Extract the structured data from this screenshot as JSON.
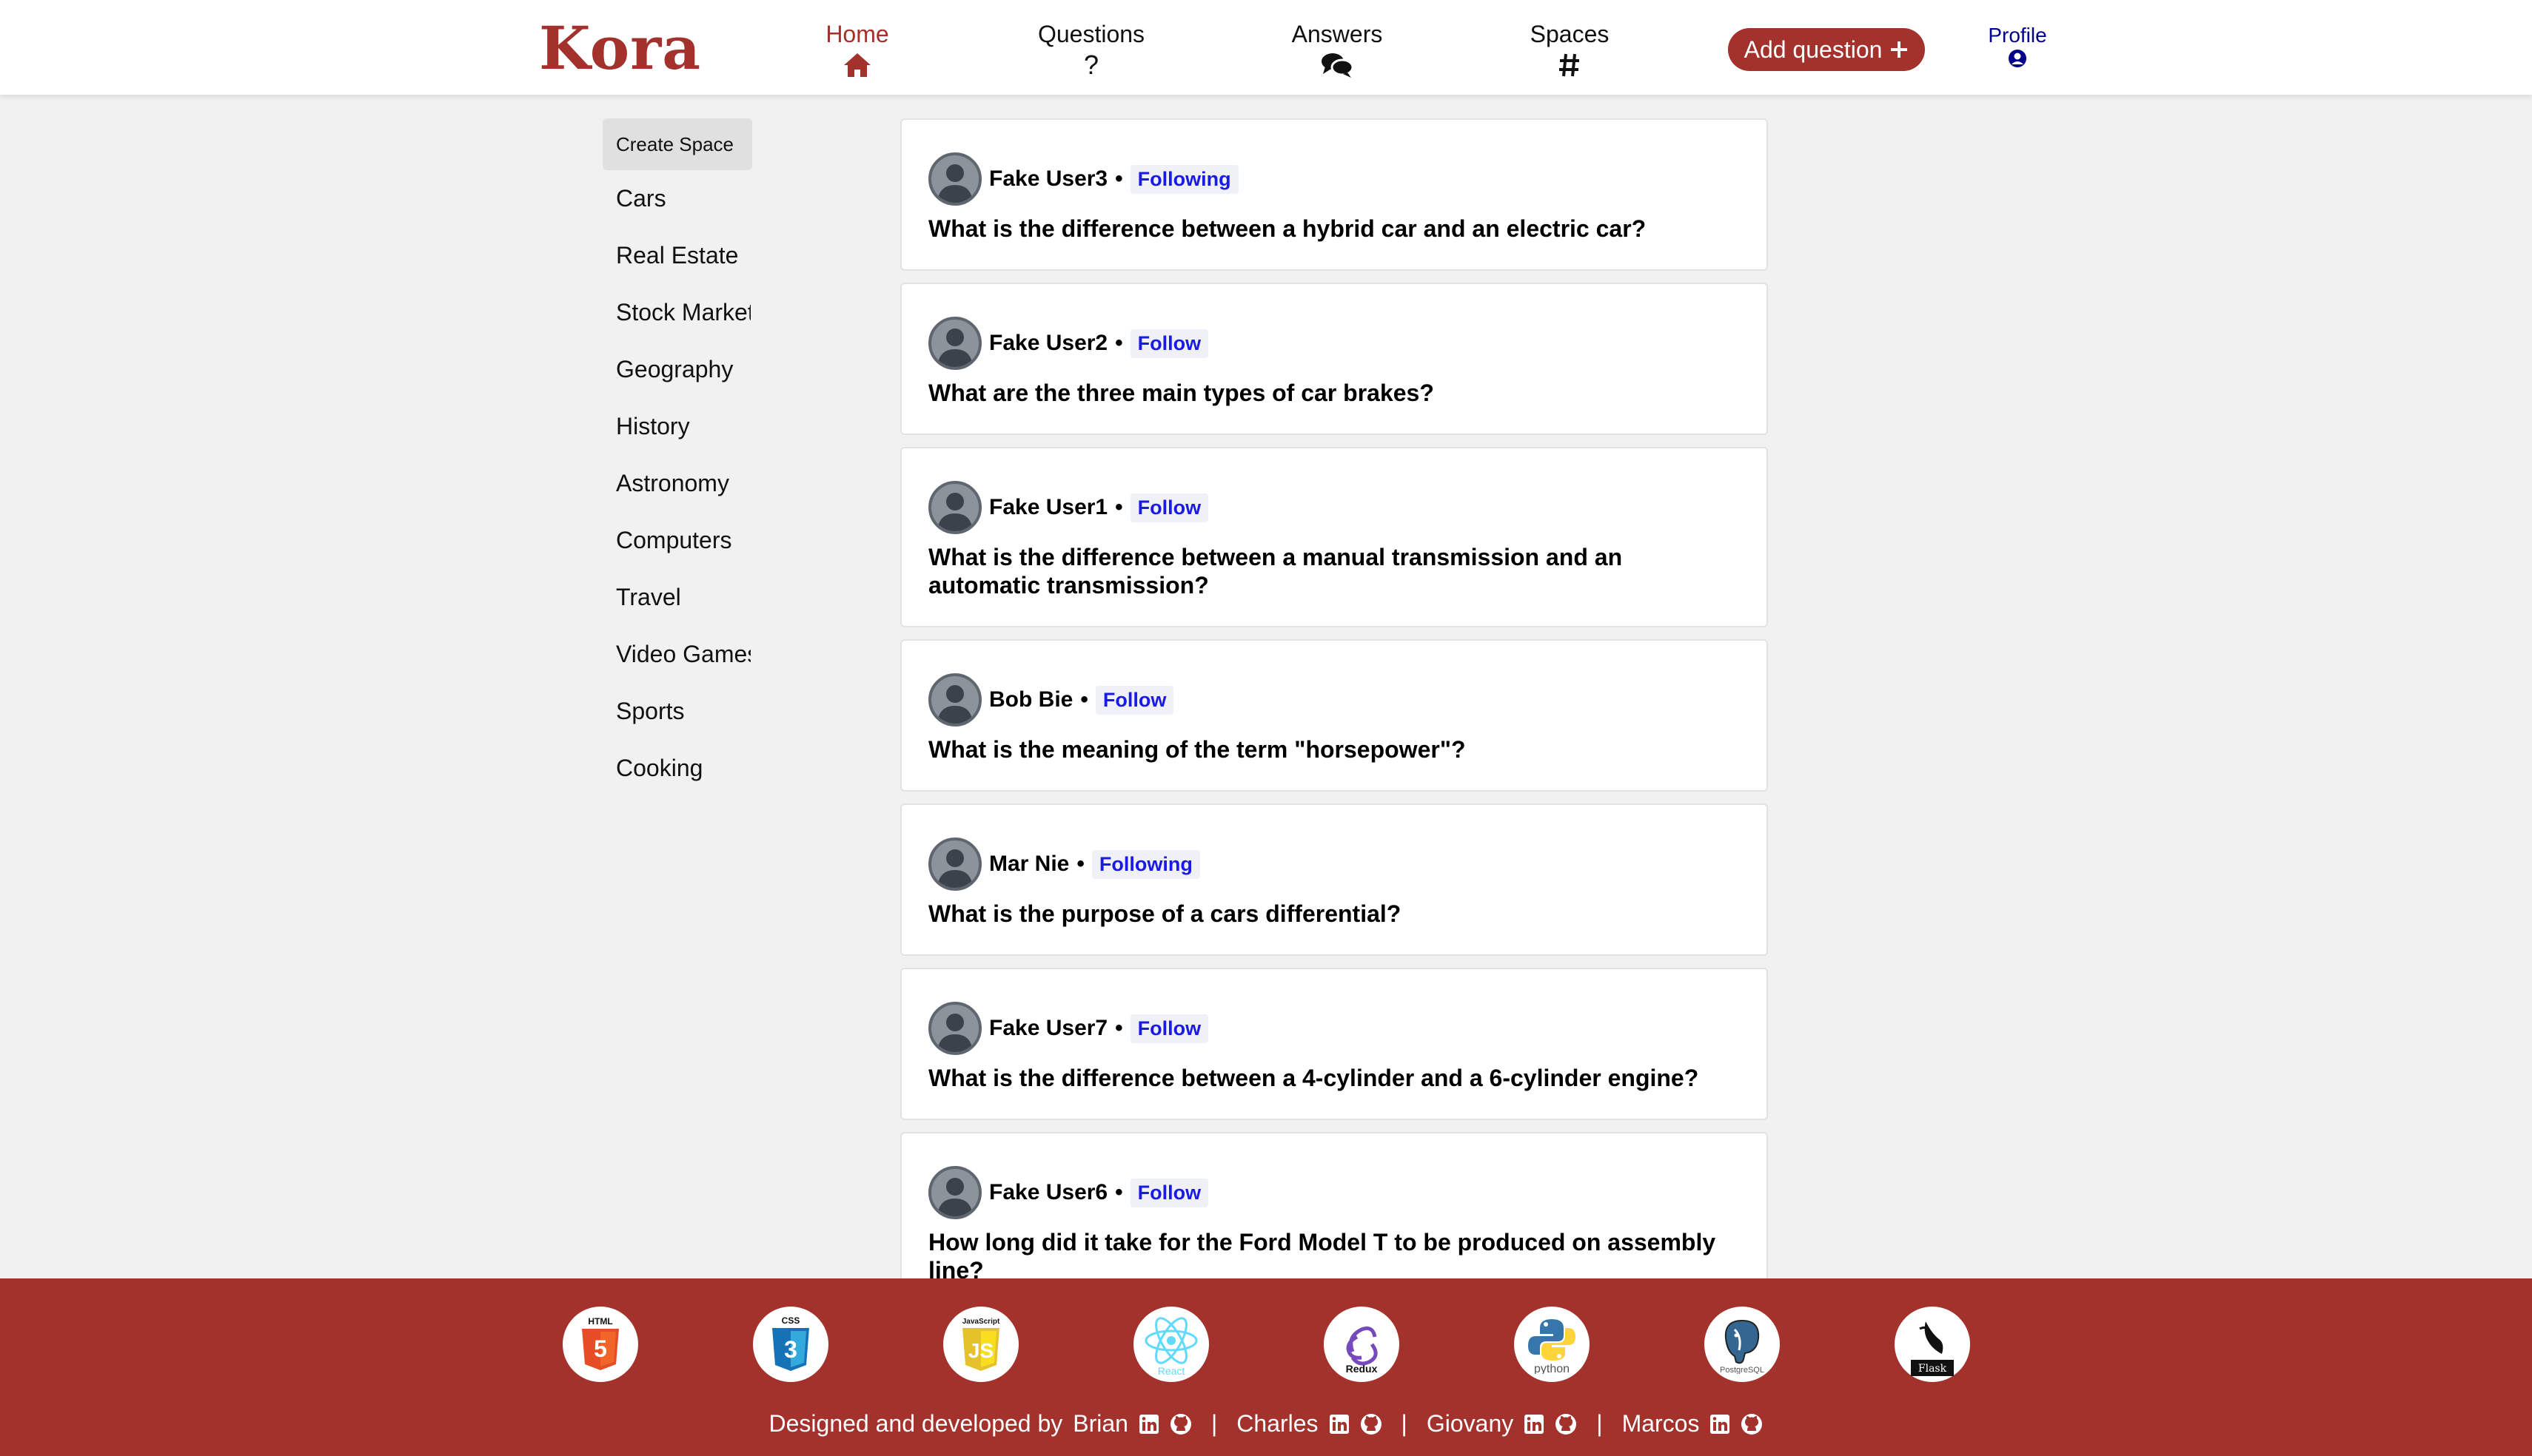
{
  "header": {
    "logo": "Kora",
    "nav": {
      "home": "Home",
      "questions": "Questions",
      "answers": "Answers",
      "spaces": "Spaces"
    },
    "add_question": "Add question",
    "profile": "Profile",
    "accent_color": "#a3312c"
  },
  "sidebar": {
    "create_space": "Create Space",
    "items": [
      "Cars",
      "Real Estate",
      "Stock Market",
      "Geography",
      "History",
      "Astronomy",
      "Computers",
      "Travel",
      "Video Games",
      "Sports",
      "Cooking"
    ]
  },
  "feed": [
    {
      "user": "Fake User3",
      "follow": "Following",
      "question": "What is the difference between a hybrid car and an electric car?"
    },
    {
      "user": "Fake User2",
      "follow": "Follow",
      "question": "What are the three main types of car brakes?"
    },
    {
      "user": "Fake User1",
      "follow": "Follow",
      "question": "What is the difference between a manual transmission and an automatic transmission?"
    },
    {
      "user": "Bob Bie",
      "follow": "Follow",
      "question": "What is the meaning of the term \"horsepower\"?"
    },
    {
      "user": "Mar Nie",
      "follow": "Following",
      "question": "What is the purpose of a cars differential?"
    },
    {
      "user": "Fake User7",
      "follow": "Follow",
      "question": "What is the difference between a 4-cylinder and a 6-cylinder engine?"
    },
    {
      "user": "Fake User6",
      "follow": "Follow",
      "question": "How long did it take for the Ford Model T to be produced on assembly line?"
    }
  ],
  "footer": {
    "tech_icons": [
      {
        "name": "html5-icon",
        "label": "HTML"
      },
      {
        "name": "css3-icon",
        "label": "CSS"
      },
      {
        "name": "javascript-icon",
        "label": "JavaScript"
      },
      {
        "name": "react-icon",
        "label": "React"
      },
      {
        "name": "redux-icon",
        "label": "Redux"
      },
      {
        "name": "python-icon",
        "label": "python"
      },
      {
        "name": "postgresql-icon",
        "label": "PostgreSQL"
      },
      {
        "name": "flask-icon",
        "label": "Flask"
      }
    ],
    "credits_prefix": "Designed and developed by",
    "developers": [
      "Brian",
      "Charles",
      "Giovany",
      "Marcos"
    ],
    "separator": "|"
  }
}
